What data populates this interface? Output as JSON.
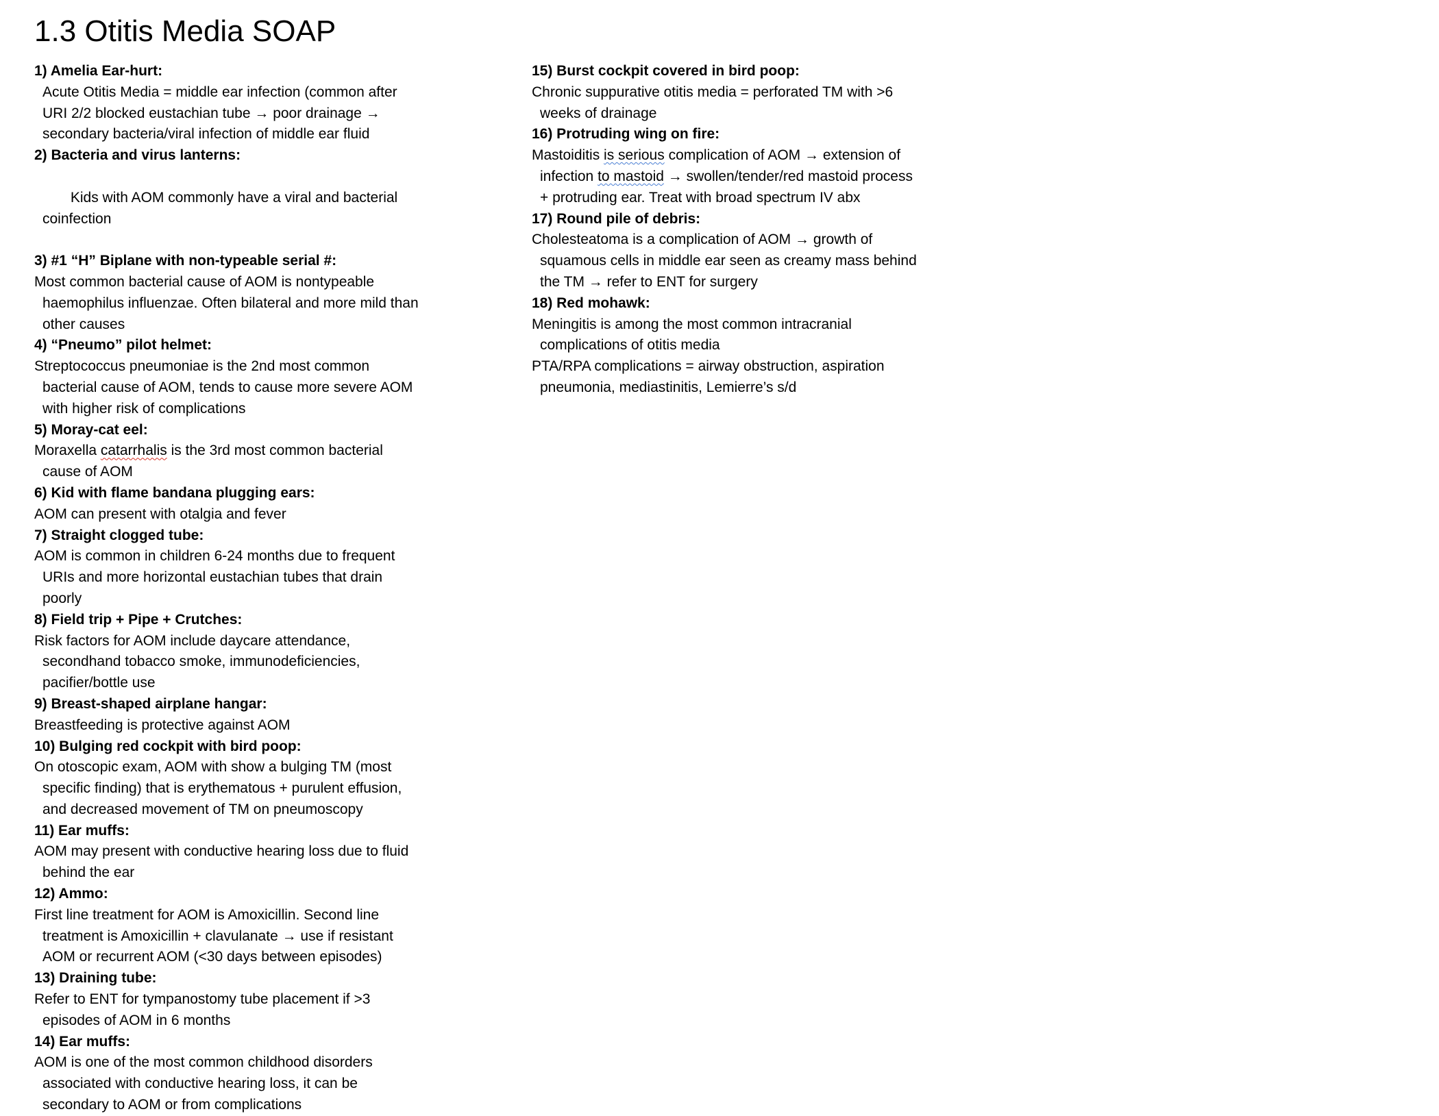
{
  "document": {
    "title": "1.3 Otitis Media SOAP"
  },
  "left_column": {
    "entries": [
      {
        "heading": "1) Amelia Ear-hurt:",
        "lines": [
          "Acute Otitis Media = middle ear infection (common after",
          "URI 2/2 blocked eustachian tube → poor drainage →",
          "secondary bacteria/viral infection of middle ear fluid"
        ]
      },
      {
        "heading": "2) Bacteria and virus lanterns:",
        "lines": [
          " Kids with AOM commonly have a viral and bacterial",
          "coinfection"
        ]
      },
      {
        "heading": "3) #1 “H” Biplane with non-typeable serial #:",
        "lines": [
          "Most common bacterial cause of AOM is nontypeable",
          "haemophilus influenzae. Often bilateral and more mild than",
          "other causes"
        ]
      },
      {
        "heading": "4) “Pneumo” pilot helmet:",
        "lines": [
          "Streptococcus pneumoniae is the 2nd most common",
          "bacterial cause of AOM, tends to cause more severe AOM",
          "with higher risk of complications"
        ]
      },
      {
        "heading": "5) Moray-cat eel:",
        "lines_before": "Moraxella ",
        "lines_flag": "catarrhalis",
        "lines_after": " is the 3rd most common bacterial",
        "lines": [
          "cause of AOM"
        ]
      },
      {
        "heading": "6) Kid with flame bandana plugging ears:",
        "lines": [
          "AOM can present with otalgia and fever"
        ]
      },
      {
        "heading": "7) Straight clogged tube:",
        "lines": [
          "AOM is common in children 6-24 months due to frequent",
          "URIs and more horizontal eustachian tubes that drain",
          "poorly"
        ]
      },
      {
        "heading": "8) Field trip + Pipe + Crutches:",
        "lines": [
          "Risk factors for AOM include daycare attendance,",
          "secondhand tobacco smoke, immunodeficiencies,",
          "pacifier/bottle use"
        ]
      },
      {
        "heading": "9) Breast-shaped airplane hangar:",
        "lines": [
          "Breastfeeding is protective against AOM"
        ]
      },
      {
        "heading": "10) Bulging red cockpit with bird poop:",
        "lines": [
          "On otoscopic exam, AOM with show a bulging TM (most",
          "specific finding) that is erythematous + purulent effusion,",
          "and decreased movement of TM on pneumoscopy"
        ]
      },
      {
        "heading": "11) Ear muffs:",
        "lines": [
          "AOM may present with conductive hearing loss due to fluid",
          "behind the ear"
        ]
      },
      {
        "heading": "12) Ammo:",
        "lines": [
          "First line treatment for AOM is Amoxicillin. Second line",
          "treatment is Amoxicillin + clavulanate → use if resistant",
          "AOM or recurrent AOM (<30 days between episodes)"
        ]
      },
      {
        "heading": "13) Draining tube:",
        "lines": [
          "Refer to ENT for tympanostomy tube placement if >3",
          "episodes of AOM in 6 months"
        ]
      },
      {
        "heading": "14) Ear muffs:",
        "lines": [
          "AOM is one of the most common childhood disorders",
          "associated with conductive hearing loss, it can be",
          "secondary to AOM or from complications"
        ]
      }
    ]
  },
  "right_column": {
    "entries": [
      {
        "heading": "15) Burst cockpit covered in bird poop:",
        "lines": [
          "Chronic suppurative otitis media = perforated TM with >6",
          "weeks of drainage"
        ]
      },
      {
        "heading": "16) Protruding wing on fire:",
        "line1_before": "Mastoiditis ",
        "line1_flag": "is serious",
        "line1_after": " complication of AOM → extension of",
        "line2_before": "infection ",
        "line2_flag": "to mastoid",
        "line2_after": " → swollen/tender/red mastoid process",
        "lines": [
          "+ protruding ear. Treat with broad spectrum IV abx"
        ]
      },
      {
        "heading": "17) Round pile of debris:",
        "lines": [
          "Cholesteatoma is a complication of AOM → growth of",
          "squamous cells in middle ear seen as creamy mass behind",
          "the TM → refer to ENT for surgery"
        ]
      },
      {
        "heading": "18) Red mohawk:",
        "lines": [
          "Meningitis is among the most common intracranial",
          "complications of otitis media",
          "PTA/RPA complications = airway obstruction, aspiration",
          "pneumonia, mediastinitis, Lemierre’s s/d"
        ]
      }
    ]
  }
}
